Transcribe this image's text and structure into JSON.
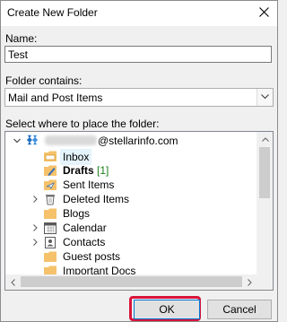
{
  "window": {
    "title": "Create New Folder"
  },
  "name_field": {
    "label": "Name:",
    "value": "Test"
  },
  "folder_contains": {
    "label": "Folder contains:",
    "selected": "Mail and Post Items"
  },
  "tree": {
    "label": "Select where to place the folder:",
    "account": {
      "suffix": "@stellarinfo.com",
      "icon": "exchange-account-icon"
    },
    "items": [
      {
        "label": "Inbox",
        "icon": "inbox-folder-icon",
        "selected": true,
        "expandable": false
      },
      {
        "label": "Drafts",
        "count": "[1]",
        "icon": "drafts-folder-icon",
        "bold": true,
        "expandable": false
      },
      {
        "label": "Sent Items",
        "icon": "sent-folder-icon",
        "expandable": false
      },
      {
        "label": "Deleted Items",
        "icon": "trash-icon",
        "expandable": true
      },
      {
        "label": "Blogs",
        "icon": "folder-icon",
        "expandable": false
      },
      {
        "label": "Calendar",
        "icon": "calendar-icon",
        "expandable": true
      },
      {
        "label": "Contacts",
        "icon": "contacts-icon",
        "expandable": true
      },
      {
        "label": "Guest posts",
        "icon": "folder-icon",
        "expandable": false
      },
      {
        "label": "Important Docs",
        "icon": "folder-icon",
        "expandable": false
      }
    ]
  },
  "buttons": {
    "ok": "OK",
    "cancel": "Cancel"
  },
  "colors": {
    "highlight": "#d8143a",
    "selection": "#e5f3fb",
    "accent": "#0078d7",
    "count": "#1a7f1a"
  }
}
